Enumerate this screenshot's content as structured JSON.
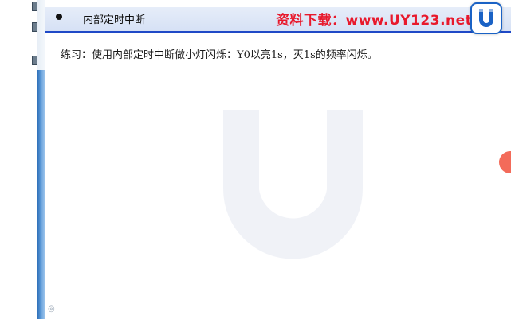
{
  "slide": {
    "header_title": "内部定时中断",
    "download_banner": "资料下载：www.UY123.net",
    "exercise_text": "练习：使用内部定时中断做小灯闪烁：Y0以亮1s，灭1s的频率闪烁。"
  },
  "icons": {
    "bullet": "bullet-dot-icon",
    "logo": "uy-magnet-logo-icon",
    "watermark": "uy-magnet-watermark-icon",
    "pointer": "laser-pointer-dot-icon",
    "slide_nav": "slide-nav-icon"
  },
  "colors": {
    "header_underline": "#1f49c7",
    "banner_red": "#e8192c",
    "logo_blue": "#1a62c5",
    "pointer_orange": "#f36b5a",
    "strip_blue": "#2d6fb8"
  }
}
